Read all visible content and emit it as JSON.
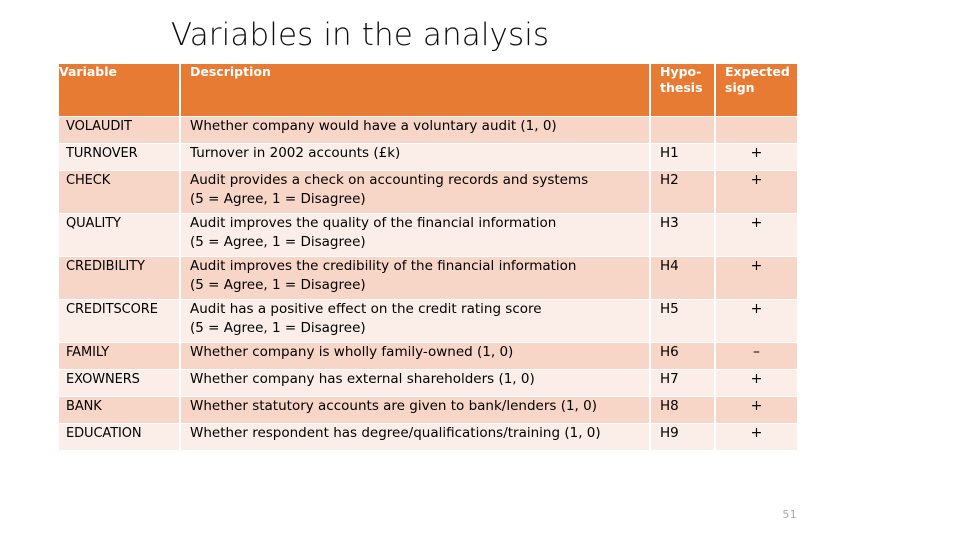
{
  "slide": {
    "title": "Variables in the analysis",
    "page_number": "51",
    "accent_color": "#E87B33",
    "row_shade_dark": "#F7D6C7",
    "row_shade_light": "#FBEEE8"
  },
  "table": {
    "headers": {
      "variable": "Variable",
      "description": "Description",
      "hypothesis": "Hypo-\nthesis",
      "hypothesis_line1": "Hypo-",
      "hypothesis_line2": "thesis",
      "expected_sign": "Expected\nsign",
      "expected_sign_line1": "Expected",
      "expected_sign_line2": "sign"
    },
    "rows": [
      {
        "variable": "VOLAUDIT",
        "description": "Whether company would have a voluntary audit (1, 0)",
        "description_line2": "",
        "hypothesis": "",
        "expected_sign": ""
      },
      {
        "variable": "TURNOVER",
        "description": "Turnover in 2002 accounts (£k)",
        "description_line2": "",
        "hypothesis": "H1",
        "expected_sign": "+"
      },
      {
        "variable": "CHECK",
        "description": "Audit provides a check on accounting records and systems",
        "description_line2": "(5 = Agree, 1 = Disagree)",
        "hypothesis": "H2",
        "expected_sign": "+"
      },
      {
        "variable": "QUALITY",
        "description": "Audit improves the quality of the financial information",
        "description_line2": "(5 = Agree, 1 = Disagree)",
        "hypothesis": "H3",
        "expected_sign": "+"
      },
      {
        "variable": "CREDIBILITY",
        "description": "Audit improves the credibility of the financial information",
        "description_line2": "(5 = Agree, 1 = Disagree)",
        "hypothesis": "H4",
        "expected_sign": "+"
      },
      {
        "variable": "CREDITSCORE",
        "description": "Audit has a positive effect on the credit rating score",
        "description_line2": "(5 = Agree, 1 = Disagree)",
        "hypothesis": "H5",
        "expected_sign": "+"
      },
      {
        "variable": "FAMILY",
        "description": "Whether company is wholly family-owned (1, 0)",
        "description_line2": "",
        "hypothesis": "H6",
        "expected_sign": "–"
      },
      {
        "variable": "EXOWNERS",
        "description": "Whether company has external shareholders (1, 0)",
        "description_line2": "",
        "hypothesis": "H7",
        "expected_sign": "+"
      },
      {
        "variable": "BANK",
        "description": "Whether statutory accounts are given to bank/lenders (1, 0)",
        "description_line2": "",
        "hypothesis": "H8",
        "expected_sign": "+"
      },
      {
        "variable": "EDUCATION",
        "description": "Whether respondent has degree/qualifications/training (1, 0)",
        "description_line2": "",
        "hypothesis": "H9",
        "expected_sign": "+"
      }
    ]
  }
}
